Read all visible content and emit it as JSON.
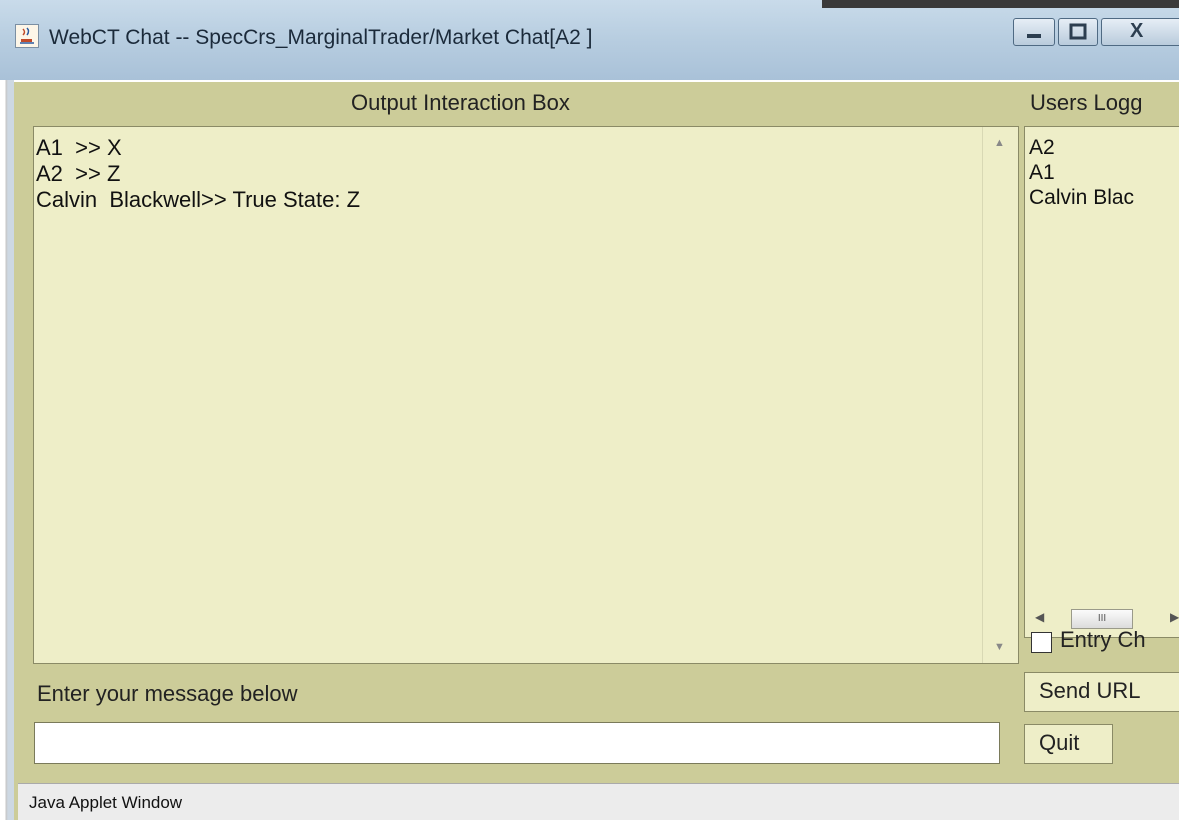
{
  "window": {
    "title": "WebCT Chat -- SpecCrs_MarginalTrader/Market Chat[A2 ]",
    "buttons": [
      "minimize",
      "maximize",
      "close"
    ],
    "close_label": "X"
  },
  "output_panel": {
    "heading": "Output Interaction Box",
    "messages": [
      "A1  >> X",
      "A2  >> Z",
      "Calvin  Blackwell>> True State: Z"
    ]
  },
  "users_panel": {
    "heading": "Users Logg",
    "users": [
      "A2",
      "A1",
      "Calvin Blac"
    ],
    "scrollbar_thumb_glyph": "III"
  },
  "entry_checkbox": {
    "label": "Entry Ch",
    "checked": false
  },
  "message_area": {
    "label": "Enter your message below",
    "value": ""
  },
  "buttons": {
    "send_url": "Send URL",
    "quit": "Quit"
  },
  "status_bar": {
    "text": "Java Applet Window"
  },
  "colors": {
    "panel_background": "#cccc99",
    "text_area_background": "#eeeec8",
    "title_bar": "#b7cde0"
  },
  "icons": {
    "app_icon": "java-cup-icon",
    "scroll_up": "arrow-up-icon",
    "scroll_down": "arrow-down-icon",
    "scroll_left": "arrow-left-icon",
    "scroll_right": "arrow-right-icon"
  }
}
